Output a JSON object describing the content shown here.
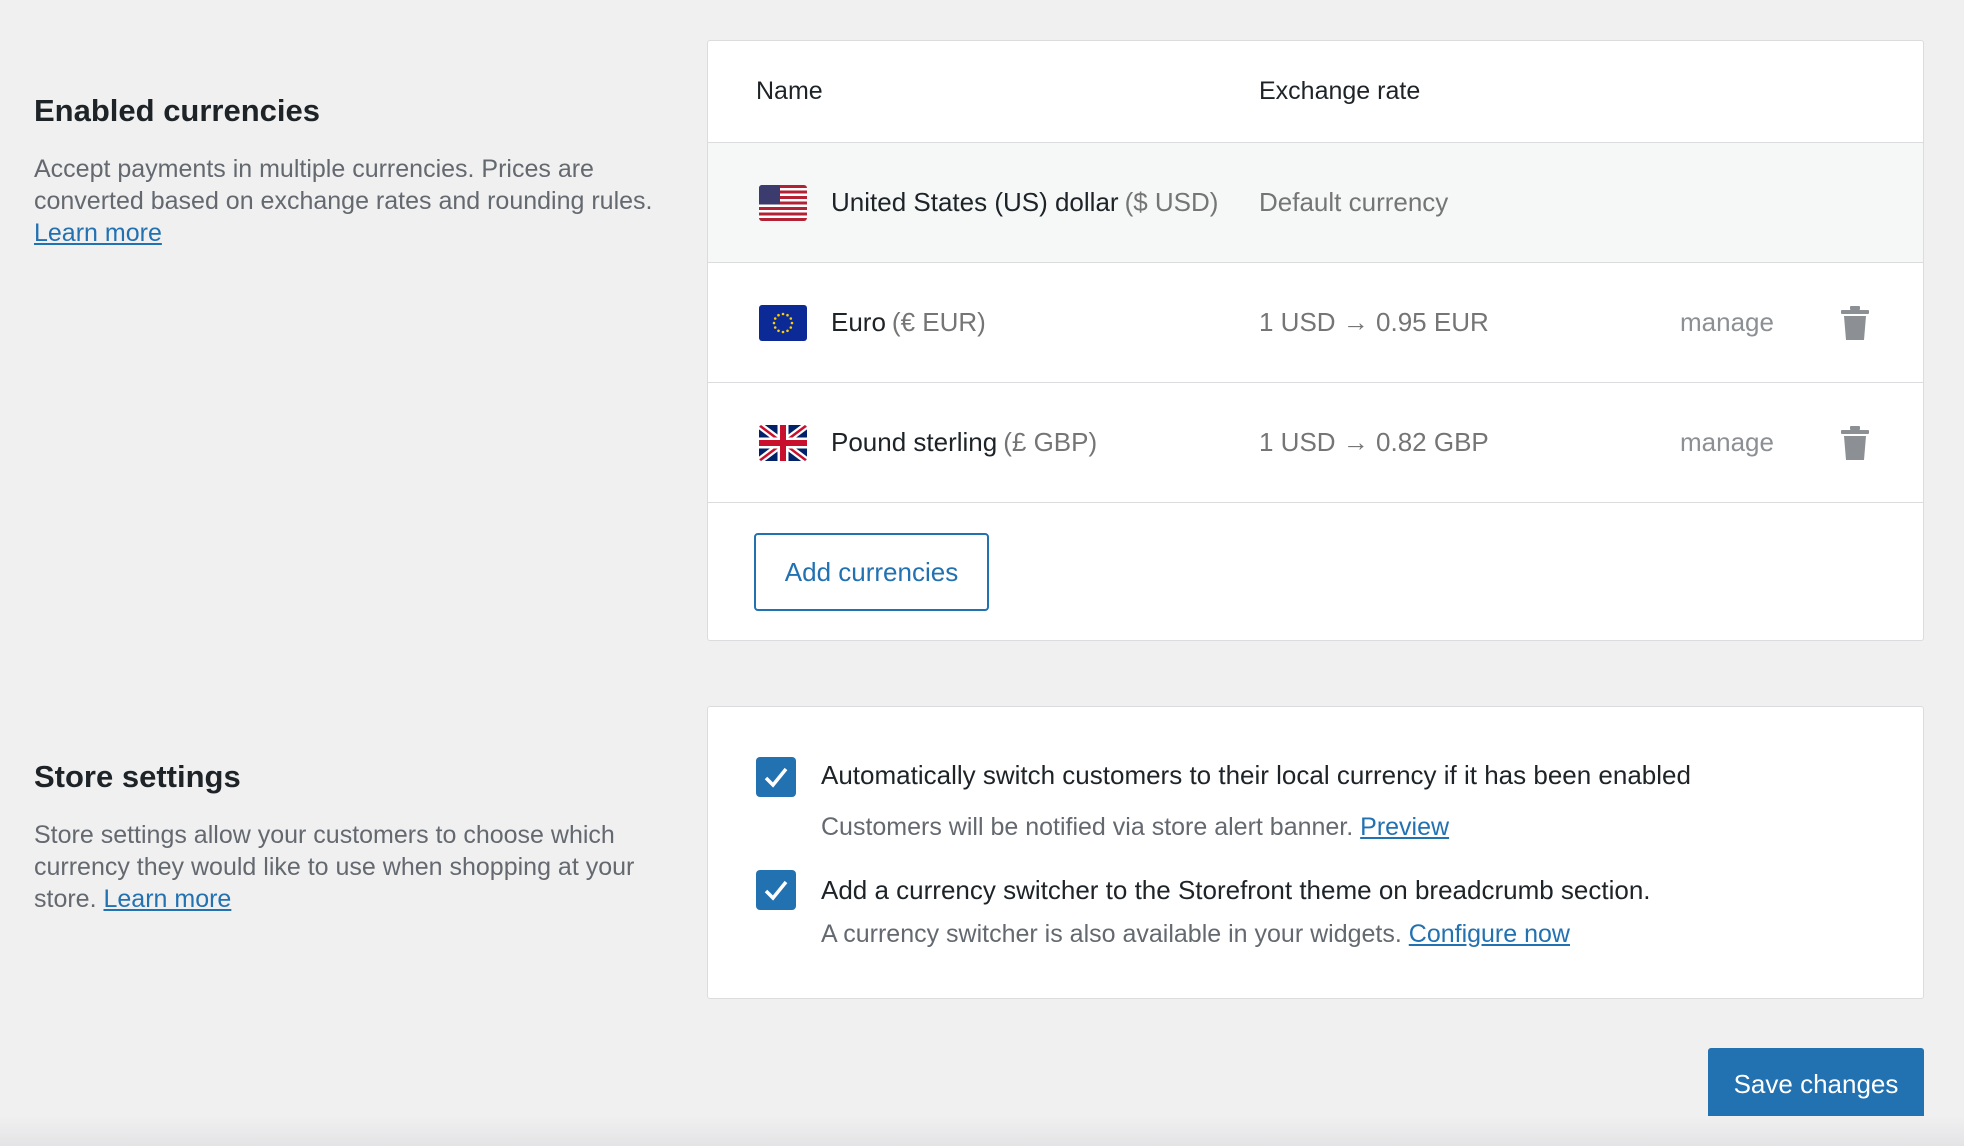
{
  "enabled_currencies": {
    "title": "Enabled currencies",
    "description": "Accept payments in multiple currencies. Prices are converted based on exchange rates and rounding rules.",
    "learn_more": "Learn more",
    "table": {
      "headers": {
        "name": "Name",
        "rate": "Exchange rate"
      },
      "rows": [
        {
          "flag": "us-flag-icon",
          "name": "United States (US) dollar",
          "code": "($ USD)",
          "rate": "Default currency"
        },
        {
          "flag": "eu-flag-icon",
          "name": "Euro",
          "code": "(€ EUR)",
          "rate": "1 USD → 0.95 EUR",
          "manage": "manage"
        },
        {
          "flag": "uk-flag-icon",
          "name": "Pound sterling",
          "code": "(£ GBP)",
          "rate": "1 USD → 0.82 GBP",
          "manage": "manage"
        }
      ]
    },
    "add_button": "Add currencies"
  },
  "store_settings": {
    "title": "Store settings",
    "description": "Store settings allow your customers to choose which currency they would like to use when shopping at your store.",
    "learn_more": "Learn more",
    "options": [
      {
        "checked": true,
        "label": "Automatically switch customers to their local currency if it has been enabled",
        "help": "Customers will be notified via store alert banner.",
        "help_link": "Preview"
      },
      {
        "checked": true,
        "label": "Add a currency switcher to the Storefront theme on breadcrumb section.",
        "help": "A currency switcher is also available in your widgets.",
        "help_link": "Configure now"
      }
    ]
  },
  "save_button": "Save changes",
  "colors": {
    "accent": "#2271b1",
    "background": "#f0f0f1"
  }
}
